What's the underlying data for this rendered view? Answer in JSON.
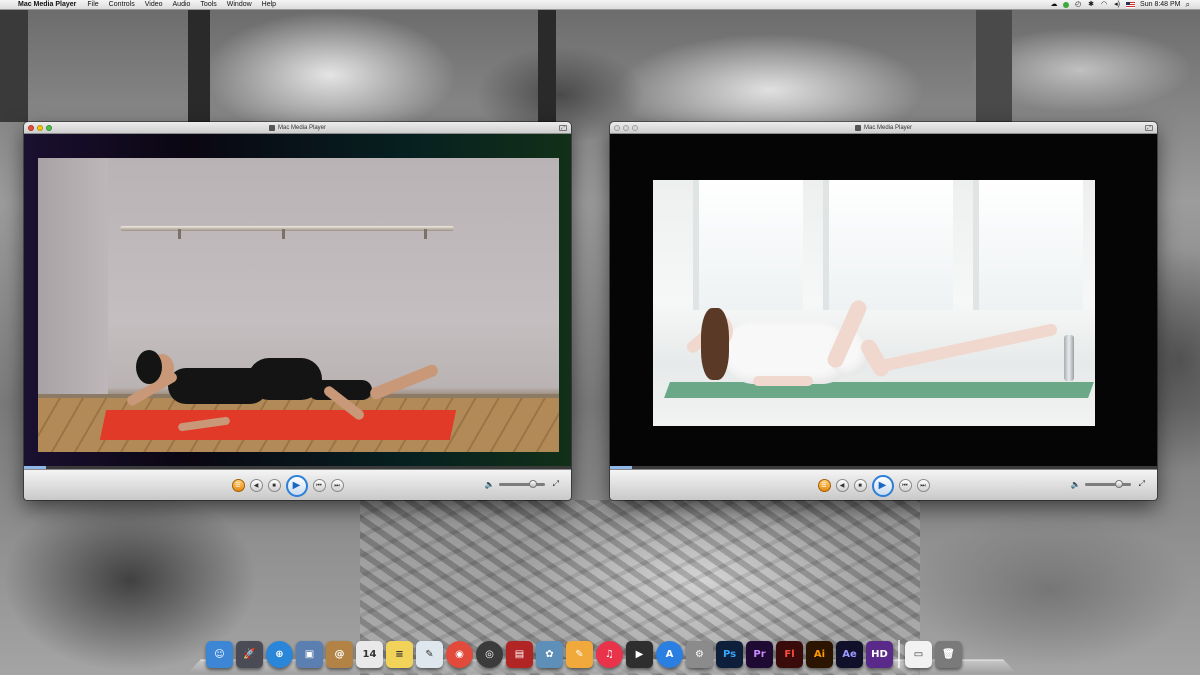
{
  "menubar": {
    "apple_symbol": "",
    "app_name": "Mac Media Player",
    "menus": [
      "File",
      "Controls",
      "Video",
      "Audio",
      "Tools",
      "Window",
      "Help"
    ],
    "clock": "Sun 8:48 PM",
    "status_icons": [
      "cloud-sync-icon",
      "green-status-icon",
      "time-machine-icon",
      "bluetooth-icon",
      "wifi-icon",
      "volume-icon",
      "flag-us-icon",
      "spotlight-icon"
    ]
  },
  "windows": [
    {
      "title": "Mac Media Player",
      "active": true,
      "progress": 0.04,
      "volume": 0.75,
      "controls": [
        "playlist",
        "rewind",
        "stop",
        "play",
        "prev",
        "next"
      ]
    },
    {
      "title": "Mac Media Player",
      "active": false,
      "progress": 0.04,
      "volume": 0.75,
      "controls": [
        "playlist",
        "rewind",
        "stop",
        "play",
        "prev",
        "next"
      ]
    }
  ],
  "control_glyphs": {
    "playlist": "☰",
    "rewind": "◀",
    "stop": "■",
    "play": "▶",
    "prev": "⏮",
    "next": "⏭",
    "volume": "🔈",
    "fullscreen": "⤢"
  },
  "dock": {
    "apps": [
      {
        "name": "finder-icon",
        "color": "#3d86d6",
        "label": "☺"
      },
      {
        "name": "launchpad-icon",
        "color": "#4b4b55",
        "label": "🚀"
      },
      {
        "name": "safari-icon",
        "color": "#2a86d8",
        "label": "⊕"
      },
      {
        "name": "preview-icon",
        "color": "#5a7fb0",
        "label": "▣"
      },
      {
        "name": "contacts-icon",
        "color": "#b38346",
        "label": "@"
      },
      {
        "name": "calendar-icon",
        "color": "#e9e9e9",
        "label": "14"
      },
      {
        "name": "notes-icon",
        "color": "#f1d35a",
        "label": "≡"
      },
      {
        "name": "textedit-icon",
        "color": "#dfe7ee",
        "label": "✎"
      },
      {
        "name": "chrome-icon",
        "color": "#e24b3b",
        "label": "◉"
      },
      {
        "name": "camera-icon",
        "color": "#3b3b3b",
        "label": "◎"
      },
      {
        "name": "photobooth-icon",
        "color": "#b12525",
        "label": "▤"
      },
      {
        "name": "iphoto-icon",
        "color": "#5d8fb8",
        "label": "✿"
      },
      {
        "name": "pages-icon",
        "color": "#f2a93b",
        "label": "✎"
      },
      {
        "name": "itunes-icon",
        "color": "#e8334a",
        "label": "♫"
      },
      {
        "name": "quicktime-icon",
        "color": "#2e2e2e",
        "label": "▶"
      },
      {
        "name": "appstore-icon",
        "color": "#2a7fe0",
        "label": "A"
      },
      {
        "name": "system-preferences-icon",
        "color": "#8b8b8b",
        "label": "⚙"
      },
      {
        "name": "photoshop-icon",
        "color": "#0e1f3c",
        "label": "Ps",
        "text_color": "#31a8ff"
      },
      {
        "name": "premiere-icon",
        "color": "#1f0a33",
        "label": "Pr",
        "text_color": "#c98aff"
      },
      {
        "name": "flash-icon",
        "color": "#3a0b0b",
        "label": "Fl",
        "text_color": "#ff4c3c"
      },
      {
        "name": "illustrator-icon",
        "color": "#2b1400",
        "label": "Ai",
        "text_color": "#ff9a00"
      },
      {
        "name": "after-effects-icon",
        "color": "#10102a",
        "label": "Ae",
        "text_color": "#9b9bff"
      },
      {
        "name": "hd-media-icon",
        "color": "#5a2a8a",
        "label": "HD"
      }
    ],
    "docs": [
      {
        "name": "document-stack-icon",
        "color": "#f2f2f2",
        "label": "▭"
      },
      {
        "name": "trash-icon",
        "color": "#7a7a7a",
        "label": "🗑"
      }
    ]
  }
}
